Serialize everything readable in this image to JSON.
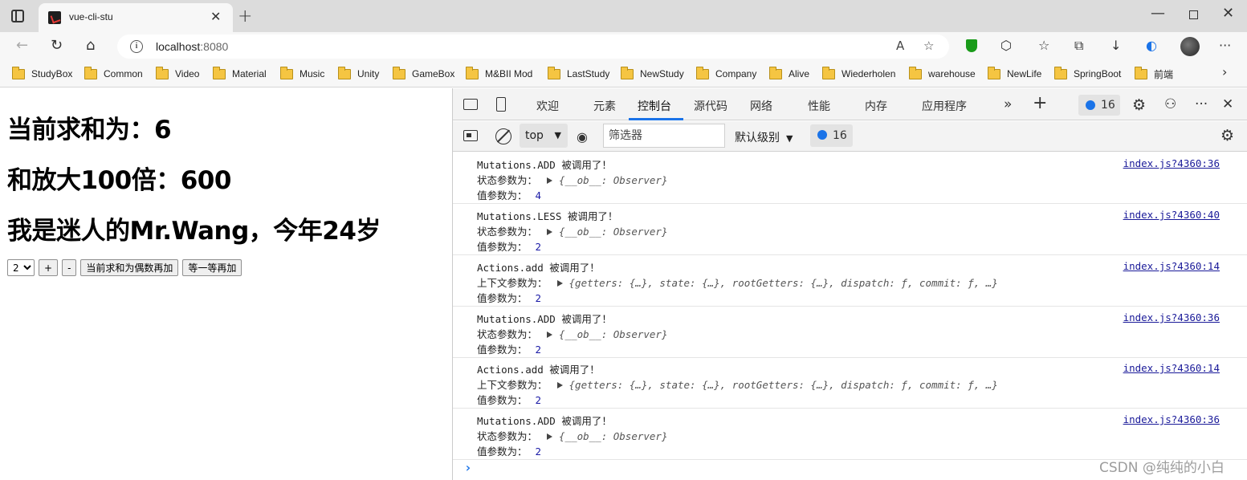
{
  "browser": {
    "tab_title": "vue-cli-stu",
    "url_host": "localhost",
    "url_port": ":8080"
  },
  "bookmarks": [
    "StudyBox",
    "Common",
    "Video",
    "Material",
    "Music",
    "Unity",
    "GameBox",
    "M&BII Mod",
    "LastStudy",
    "NewStudy",
    "Company",
    "Alive",
    "Wiederholen",
    "warehouse",
    "NewLife",
    "SpringBoot",
    "前端"
  ],
  "page": {
    "sum_text": "当前求和为：6",
    "big_text": "和放大100倍：600",
    "intro_text": "我是迷人的Mr.Wang，今年24岁",
    "select_value": "2",
    "plus_label": "+",
    "minus_label": "-",
    "odd_add_label": "当前求和为偶数再加",
    "wait_add_label": "等一等再加"
  },
  "devtools": {
    "tabs": [
      "欢迎",
      "元素",
      "控制台",
      "源代码",
      "网络",
      "性能",
      "内存",
      "应用程序"
    ],
    "active_tab": "控制台",
    "issues_count": "16",
    "context": "top",
    "filter_placeholder": "筛选器",
    "level": "默认级别",
    "message_count": "16",
    "logs": [
      {
        "title": "Mutations.ADD 被调用了！",
        "arg_label": "状态参数为：",
        "arg_obj": "{__ob__: Observer}",
        "val_label": "值参数为：",
        "val": "4",
        "source": "index.js?4360:36"
      },
      {
        "title": "Mutations.LESS 被调用了！",
        "arg_label": "状态参数为：",
        "arg_obj": "{__ob__: Observer}",
        "val_label": "值参数为：",
        "val": "2",
        "source": "index.js?4360:40"
      },
      {
        "title": "Actions.add 被调用了！",
        "arg_label": "上下文参数为：",
        "arg_obj": "{getters: {…}, state: {…}, rootGetters: {…}, dispatch: ƒ, commit: ƒ, …}",
        "val_label": "值参数为：",
        "val": "2",
        "source": "index.js?4360:14"
      },
      {
        "title": "Mutations.ADD 被调用了！",
        "arg_label": "状态参数为：",
        "arg_obj": "{__ob__: Observer}",
        "val_label": "值参数为：",
        "val": "2",
        "source": "index.js?4360:36"
      },
      {
        "title": "Actions.add 被调用了！",
        "arg_label": "上下文参数为：",
        "arg_obj": "{getters: {…}, state: {…}, rootGetters: {…}, dispatch: ƒ, commit: ƒ, …}",
        "val_label": "值参数为：",
        "val": "2",
        "source": "index.js?4360:14"
      },
      {
        "title": "Mutations.ADD 被调用了！",
        "arg_label": "状态参数为：",
        "arg_obj": "{__ob__: Observer}",
        "val_label": "值参数为：",
        "val": "2",
        "source": "index.js?4360:36"
      }
    ]
  },
  "watermark": "CSDN @纯纯的小白"
}
